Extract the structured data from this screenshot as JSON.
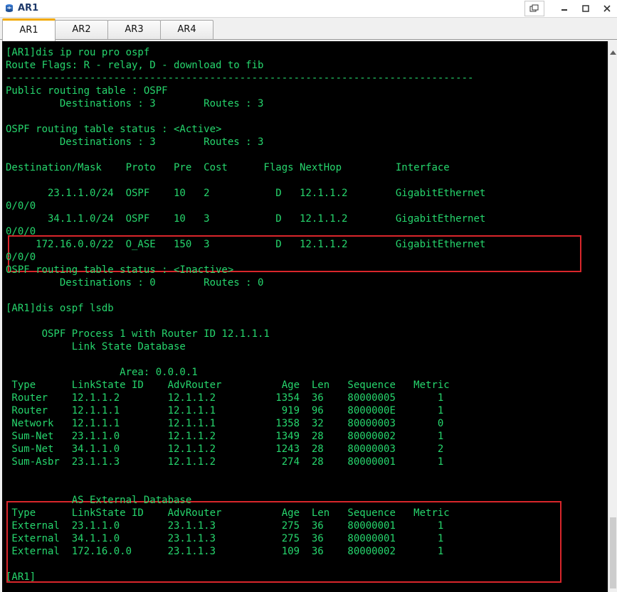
{
  "window": {
    "title": "AR1"
  },
  "tabs": [
    "AR1",
    "AR2",
    "AR3",
    "AR4"
  ],
  "active_tab": "AR1",
  "terminal": {
    "lines": [
      "[AR1]dis ip rou pro ospf",
      "Route Flags: R - relay, D - download to fib",
      "------------------------------------------------------------------------------",
      "Public routing table : OSPF",
      "         Destinations : 3        Routes : 3",
      "",
      "OSPF routing table status : <Active>",
      "         Destinations : 3        Routes : 3",
      "",
      "Destination/Mask    Proto   Pre  Cost      Flags NextHop         Interface",
      "",
      "       23.1.1.0/24  OSPF    10   2           D   12.1.1.2        GigabitEthernet",
      "0/0/0",
      "       34.1.1.0/24  OSPF    10   3           D   12.1.1.2        GigabitEthernet",
      "0/0/0",
      "     172.16.0.0/22  O_ASE   150  3           D   12.1.1.2        GigabitEthernet",
      "0/0/0",
      "OSPF routing table status : <Inactive>",
      "         Destinations : 0        Routes : 0",
      "",
      "[AR1]dis ospf lsdb",
      "",
      "      OSPF Process 1 with Router ID 12.1.1.1",
      "           Link State Database",
      "",
      "                   Area: 0.0.0.1",
      " Type      LinkState ID    AdvRouter          Age  Len   Sequence   Metric",
      " Router    12.1.1.2        12.1.1.2          1354  36    80000005       1",
      " Router    12.1.1.1        12.1.1.1           919  96    8000000E       1",
      " Network   12.1.1.1        12.1.1.1          1358  32    80000003       0",
      " Sum-Net   23.1.1.0        12.1.1.2          1349  28    80000002       1",
      " Sum-Net   34.1.1.0        12.1.1.2          1243  28    80000003       2",
      " Sum-Asbr  23.1.1.3        12.1.1.2           274  28    80000001       1",
      "",
      "",
      "           AS External Database",
      " Type      LinkState ID    AdvRouter          Age  Len   Sequence   Metric",
      " External  23.1.1.0        23.1.1.3           275  36    80000001       1",
      " External  34.1.1.0        23.1.1.3           275  36    80000001       1",
      " External  172.16.0.0      23.1.1.3           109  36    80000002       1",
      "",
      "[AR1]"
    ]
  },
  "colors": {
    "terminal_bg": "#000000",
    "terminal_text": "#26d66d",
    "highlight_box": "#d9262b",
    "active_tab_accent": "#f2a900"
  },
  "icons": {
    "app": "router-app-icon",
    "restore": "restore-window-icon",
    "minimize": "minimize-icon",
    "maximize": "maximize-icon",
    "close": "close-icon"
  }
}
